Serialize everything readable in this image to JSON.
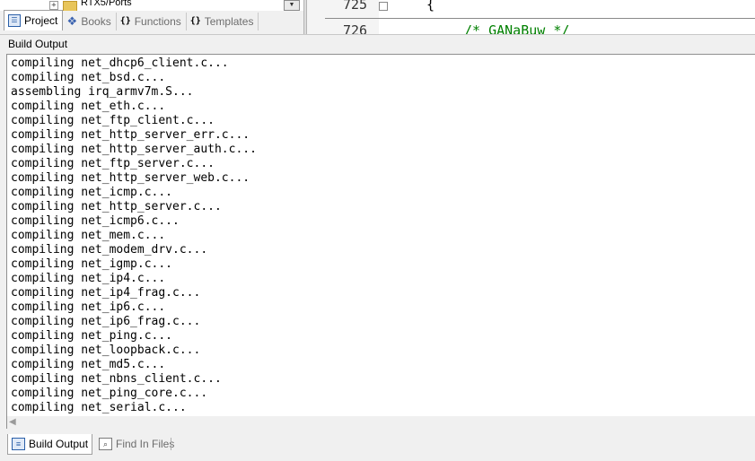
{
  "project_tree": {
    "visible_item": "RTX5/Ports"
  },
  "project_tabs": [
    {
      "label": "Project",
      "icon": "project-icon",
      "active": true
    },
    {
      "label": "Books",
      "icon": "books-icon",
      "active": false
    },
    {
      "label": "Functions",
      "icon": "functions-icon",
      "active": false
    },
    {
      "label": "Templates",
      "icon": "templates-icon",
      "active": false
    }
  ],
  "editor": {
    "line_numbers": [
      "725",
      "726"
    ],
    "lines": [
      "{",
      "/* GANaBuw */"
    ]
  },
  "build_output": {
    "title": "Build Output",
    "lines": [
      "compiling net_dhcp6_client.c...",
      "compiling net_bsd.c...",
      "assembling irq_armv7m.S...",
      "compiling net_eth.c...",
      "compiling net_ftp_client.c...",
      "compiling net_http_server_err.c...",
      "compiling net_http_server_auth.c...",
      "compiling net_ftp_server.c...",
      "compiling net_http_server_web.c...",
      "compiling net_icmp.c...",
      "compiling net_http_server.c...",
      "compiling net_icmp6.c...",
      "compiling net_mem.c...",
      "compiling net_modem_drv.c...",
      "compiling net_igmp.c...",
      "compiling net_ip4.c...",
      "compiling net_ip4_frag.c...",
      "compiling net_ip6.c...",
      "compiling net_ip6_frag.c...",
      "compiling net_ping.c...",
      "compiling net_loopback.c...",
      "compiling net_md5.c...",
      "compiling net_nbns_client.c...",
      "compiling net_ping_core.c...",
      "compiling net_serial.c..."
    ]
  },
  "bottom_tabs": [
    {
      "label": "Build Output",
      "icon": "build-output-icon",
      "active": true
    },
    {
      "label": "Find In Files",
      "icon": "find-in-files-icon",
      "active": false
    }
  ],
  "colors": {
    "accent": "#2a5fa8",
    "comment_green": "#008000"
  }
}
